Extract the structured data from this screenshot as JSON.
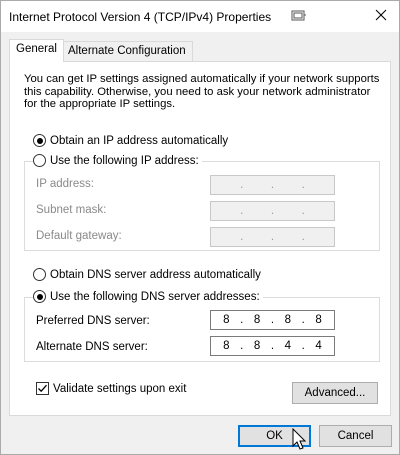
{
  "window": {
    "title": "Internet Protocol Version 4 (TCP/IPv4) Properties",
    "close_glyph": "✕"
  },
  "tabs": [
    {
      "label": "General",
      "active": true
    },
    {
      "label": "Alternate Configuration",
      "active": false
    }
  ],
  "description": "You can get IP settings assigned automatically if your network supports\nthis capability. Otherwise, you need to ask your network administrator\nfor the appropriate IP settings.",
  "ip_settings": {
    "auto_label": "Obtain an IP address automatically",
    "auto_selected": true,
    "manual_label": "Use the following IP address:",
    "manual_selected": false,
    "fields": [
      {
        "label": "IP address:",
        "octets": [
          "",
          "",
          "",
          ""
        ],
        "disabled": true
      },
      {
        "label": "Subnet mask:",
        "octets": [
          "",
          "",
          "",
          ""
        ],
        "disabled": true
      },
      {
        "label": "Default gateway:",
        "octets": [
          "",
          "",
          "",
          ""
        ],
        "disabled": true
      }
    ]
  },
  "dns_settings": {
    "auto_label": "Obtain DNS server address automatically",
    "auto_selected": false,
    "manual_label": "Use the following DNS server addresses:",
    "manual_selected": true,
    "preferred": {
      "label": "Preferred DNS server:",
      "octets": [
        "8",
        "8",
        "8",
        "8"
      ]
    },
    "alternate": {
      "label": "Alternate DNS server:",
      "octets": [
        "8",
        "8",
        "4",
        "4"
      ]
    }
  },
  "validate": {
    "label": "Validate settings upon exit",
    "checked": true
  },
  "buttons": {
    "advanced": "Advanced...",
    "ok": "OK",
    "cancel": "Cancel"
  },
  "icons": {
    "window_icon": "network-adapter-icon",
    "close": "close-icon",
    "cursor": "mouse-pointer-icon"
  },
  "colors": {
    "accent": "#0078d7",
    "disabled_text": "#8a8a8a"
  }
}
